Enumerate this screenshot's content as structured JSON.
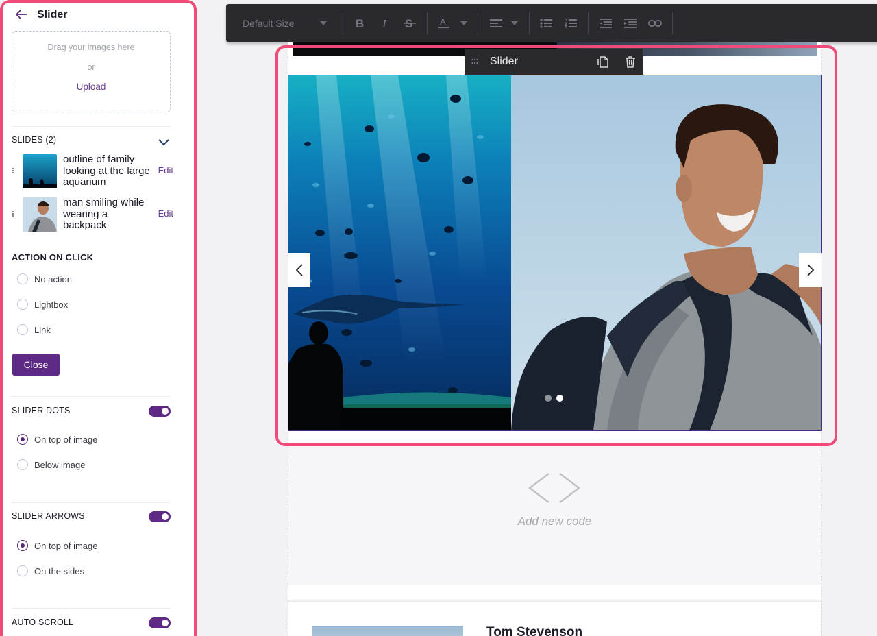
{
  "sidebar": {
    "title": "Slider",
    "dropzone": {
      "line1": "Drag your images here",
      "line2": "or",
      "upload": "Upload"
    },
    "slides_title": "SLIDES (2)",
    "slides": [
      {
        "label": "outline of family looking at the large aquarium",
        "edit": "Edit"
      },
      {
        "label": "man smiling while wearing a backpack",
        "edit": "Edit"
      }
    ],
    "action_title": "ACTION ON CLICK",
    "actions": [
      "No action",
      "Lightbox",
      "Link"
    ],
    "close": "Close",
    "dots_title": "SLIDER DOTS",
    "dots_options": [
      "On top of image",
      "Below image"
    ],
    "arrows_title": "SLIDER ARROWS",
    "arrows_options": [
      "On top of image",
      "On the sides"
    ],
    "autoscroll_title": "AUTO SCROLL"
  },
  "toolbar": {
    "font_size": "Default Size"
  },
  "slider": {
    "label": "Slider"
  },
  "code_block": {
    "label": "Add new code"
  },
  "card": {
    "name": "Tom Stevenson"
  },
  "colors": {
    "accent": "#5e2a86",
    "highlight": "#f04a78",
    "toolbar": "#2a2a2e"
  }
}
